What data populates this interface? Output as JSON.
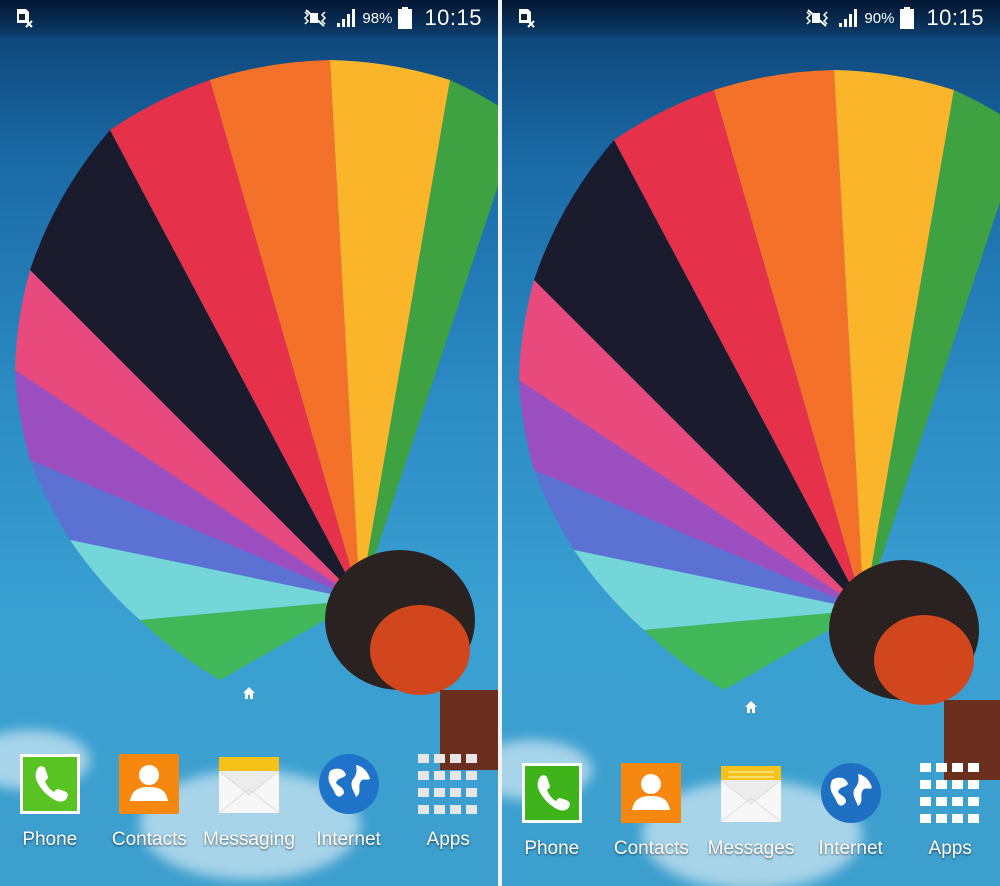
{
  "screens": [
    {
      "status": {
        "battery_percent": "98%",
        "time": "10:15",
        "battery_level": 0.98
      },
      "dock": [
        {
          "label": "Phone",
          "icon": "phone-icon"
        },
        {
          "label": "Contacts",
          "icon": "contacts-icon"
        },
        {
          "label": "Messaging",
          "icon": "messaging-icon"
        },
        {
          "label": "Internet",
          "icon": "internet-globe-icon"
        },
        {
          "label": "Apps",
          "icon": "apps-grid-icon"
        }
      ]
    },
    {
      "status": {
        "battery_percent": "90%",
        "time": "10:15",
        "battery_level": 0.9
      },
      "dock": [
        {
          "label": "Phone",
          "icon": "phone-icon"
        },
        {
          "label": "Contacts",
          "icon": "contacts-icon"
        },
        {
          "label": "Messages",
          "icon": "messaging-icon"
        },
        {
          "label": "Internet",
          "icon": "internet-globe-icon"
        },
        {
          "label": "Apps",
          "icon": "apps-grid-icon"
        }
      ]
    }
  ],
  "colors": {
    "phone": "#58c322",
    "contacts": "#f7880f",
    "mail_flap": "#f6c21a",
    "globe": "#1f74c9"
  }
}
